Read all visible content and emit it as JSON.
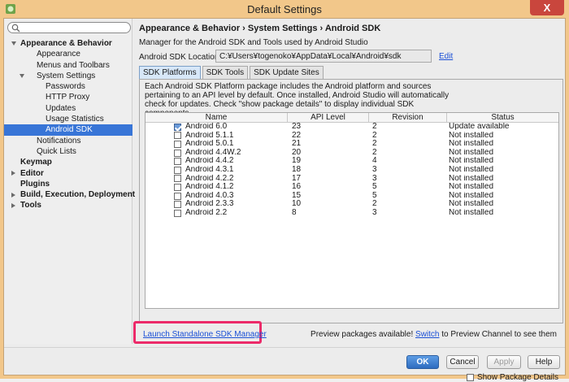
{
  "window": {
    "title": "Default Settings",
    "close_label": "X"
  },
  "search": {
    "value": "",
    "placeholder": ""
  },
  "sidebar": {
    "items": [
      {
        "label": "Appearance & Behavior",
        "indent": 0,
        "bold": true,
        "arrow": "down"
      },
      {
        "label": "Appearance",
        "indent": 1
      },
      {
        "label": "Menus and Toolbars",
        "indent": 1
      },
      {
        "label": "System Settings",
        "indent": 1,
        "arrow": "down"
      },
      {
        "label": "Passwords",
        "indent": 2
      },
      {
        "label": "HTTP Proxy",
        "indent": 2
      },
      {
        "label": "Updates",
        "indent": 2
      },
      {
        "label": "Usage Statistics",
        "indent": 2
      },
      {
        "label": "Android SDK",
        "indent": 2,
        "selected": true
      },
      {
        "label": "Notifications",
        "indent": 1
      },
      {
        "label": "Quick Lists",
        "indent": 1
      },
      {
        "label": "Keymap",
        "indent": 0,
        "bold": true
      },
      {
        "label": "Editor",
        "indent": 0,
        "bold": true,
        "arrow": "right"
      },
      {
        "label": "Plugins",
        "indent": 0,
        "bold": true
      },
      {
        "label": "Build, Execution, Deployment",
        "indent": 0,
        "bold": true,
        "arrow": "right"
      },
      {
        "label": "Tools",
        "indent": 0,
        "bold": true,
        "arrow": "right"
      }
    ]
  },
  "main": {
    "breadcrumb": "Appearance & Behavior › System Settings › Android SDK",
    "description": "Manager for the Android SDK and Tools used by Android Studio",
    "location_label": "Android SDK Location:",
    "location_value": "C:¥Users¥togenoko¥AppData¥Local¥Android¥sdk",
    "edit_label": "Edit",
    "tabs": [
      "SDK Platforms",
      "SDK Tools",
      "SDK Update Sites"
    ],
    "panel_text": "Each Android SDK Platform package includes the Android platform and sources pertaining to an API level by default. Once installed, Android Studio will automatically check for updates. Check \"show package details\" to display individual SDK components.",
    "table": {
      "headers": [
        "Name",
        "API Level",
        "Revision",
        "Status"
      ],
      "rows": [
        {
          "checked": true,
          "name": "Android 6.0",
          "api": "23",
          "rev": "2",
          "status": "Update available"
        },
        {
          "checked": false,
          "name": "Android 5.1.1",
          "api": "22",
          "rev": "2",
          "status": "Not installed"
        },
        {
          "checked": false,
          "name": "Android 5.0.1",
          "api": "21",
          "rev": "2",
          "status": "Not installed"
        },
        {
          "checked": false,
          "name": "Android 4.4W.2",
          "api": "20",
          "rev": "2",
          "status": "Not installed"
        },
        {
          "checked": false,
          "name": "Android 4.4.2",
          "api": "19",
          "rev": "4",
          "status": "Not installed"
        },
        {
          "checked": false,
          "name": "Android 4.3.1",
          "api": "18",
          "rev": "3",
          "status": "Not installed"
        },
        {
          "checked": false,
          "name": "Android 4.2.2",
          "api": "17",
          "rev": "3",
          "status": "Not installed"
        },
        {
          "checked": false,
          "name": "Android 4.1.2",
          "api": "16",
          "rev": "5",
          "status": "Not installed"
        },
        {
          "checked": false,
          "name": "Android 4.0.3",
          "api": "15",
          "rev": "5",
          "status": "Not installed"
        },
        {
          "checked": false,
          "name": "Android 2.3.3",
          "api": "10",
          "rev": "2",
          "status": "Not installed"
        },
        {
          "checked": false,
          "name": "Android 2.2",
          "api": "8",
          "rev": "3",
          "status": "Not installed"
        }
      ]
    },
    "show_details_label": "Show Package Details",
    "launch_label": "Launch Standalone SDK Manager",
    "preview_prefix": "Preview packages available! ",
    "preview_link": "Switch",
    "preview_suffix": " to Preview Channel to see them"
  },
  "footer": {
    "ok": "OK",
    "cancel": "Cancel",
    "apply": "Apply",
    "help": "Help"
  },
  "colors": {
    "selection": "#3875d7",
    "highlight_box": "#ec2a69",
    "link": "#1a4fd6",
    "frame": "#f2c78a"
  }
}
